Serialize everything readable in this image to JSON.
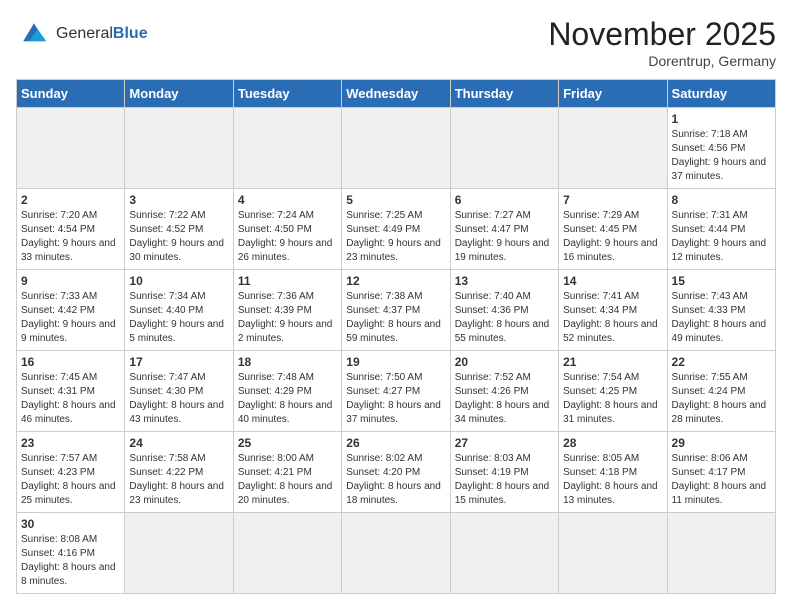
{
  "header": {
    "logo_general": "General",
    "logo_blue": "Blue",
    "title": "November 2025",
    "location": "Dorentrup, Germany"
  },
  "weekdays": [
    "Sunday",
    "Monday",
    "Tuesday",
    "Wednesday",
    "Thursday",
    "Friday",
    "Saturday"
  ],
  "weeks": [
    [
      {
        "day": null,
        "info": null
      },
      {
        "day": null,
        "info": null
      },
      {
        "day": null,
        "info": null
      },
      {
        "day": null,
        "info": null
      },
      {
        "day": null,
        "info": null
      },
      {
        "day": null,
        "info": null
      },
      {
        "day": "1",
        "info": "Sunrise: 7:18 AM\nSunset: 4:56 PM\nDaylight: 9 hours and 37 minutes."
      }
    ],
    [
      {
        "day": "2",
        "info": "Sunrise: 7:20 AM\nSunset: 4:54 PM\nDaylight: 9 hours and 33 minutes."
      },
      {
        "day": "3",
        "info": "Sunrise: 7:22 AM\nSunset: 4:52 PM\nDaylight: 9 hours and 30 minutes."
      },
      {
        "day": "4",
        "info": "Sunrise: 7:24 AM\nSunset: 4:50 PM\nDaylight: 9 hours and 26 minutes."
      },
      {
        "day": "5",
        "info": "Sunrise: 7:25 AM\nSunset: 4:49 PM\nDaylight: 9 hours and 23 minutes."
      },
      {
        "day": "6",
        "info": "Sunrise: 7:27 AM\nSunset: 4:47 PM\nDaylight: 9 hours and 19 minutes."
      },
      {
        "day": "7",
        "info": "Sunrise: 7:29 AM\nSunset: 4:45 PM\nDaylight: 9 hours and 16 minutes."
      },
      {
        "day": "8",
        "info": "Sunrise: 7:31 AM\nSunset: 4:44 PM\nDaylight: 9 hours and 12 minutes."
      }
    ],
    [
      {
        "day": "9",
        "info": "Sunrise: 7:33 AM\nSunset: 4:42 PM\nDaylight: 9 hours and 9 minutes."
      },
      {
        "day": "10",
        "info": "Sunrise: 7:34 AM\nSunset: 4:40 PM\nDaylight: 9 hours and 5 minutes."
      },
      {
        "day": "11",
        "info": "Sunrise: 7:36 AM\nSunset: 4:39 PM\nDaylight: 9 hours and 2 minutes."
      },
      {
        "day": "12",
        "info": "Sunrise: 7:38 AM\nSunset: 4:37 PM\nDaylight: 8 hours and 59 minutes."
      },
      {
        "day": "13",
        "info": "Sunrise: 7:40 AM\nSunset: 4:36 PM\nDaylight: 8 hours and 55 minutes."
      },
      {
        "day": "14",
        "info": "Sunrise: 7:41 AM\nSunset: 4:34 PM\nDaylight: 8 hours and 52 minutes."
      },
      {
        "day": "15",
        "info": "Sunrise: 7:43 AM\nSunset: 4:33 PM\nDaylight: 8 hours and 49 minutes."
      }
    ],
    [
      {
        "day": "16",
        "info": "Sunrise: 7:45 AM\nSunset: 4:31 PM\nDaylight: 8 hours and 46 minutes."
      },
      {
        "day": "17",
        "info": "Sunrise: 7:47 AM\nSunset: 4:30 PM\nDaylight: 8 hours and 43 minutes."
      },
      {
        "day": "18",
        "info": "Sunrise: 7:48 AM\nSunset: 4:29 PM\nDaylight: 8 hours and 40 minutes."
      },
      {
        "day": "19",
        "info": "Sunrise: 7:50 AM\nSunset: 4:27 PM\nDaylight: 8 hours and 37 minutes."
      },
      {
        "day": "20",
        "info": "Sunrise: 7:52 AM\nSunset: 4:26 PM\nDaylight: 8 hours and 34 minutes."
      },
      {
        "day": "21",
        "info": "Sunrise: 7:54 AM\nSunset: 4:25 PM\nDaylight: 8 hours and 31 minutes."
      },
      {
        "day": "22",
        "info": "Sunrise: 7:55 AM\nSunset: 4:24 PM\nDaylight: 8 hours and 28 minutes."
      }
    ],
    [
      {
        "day": "23",
        "info": "Sunrise: 7:57 AM\nSunset: 4:23 PM\nDaylight: 8 hours and 25 minutes."
      },
      {
        "day": "24",
        "info": "Sunrise: 7:58 AM\nSunset: 4:22 PM\nDaylight: 8 hours and 23 minutes."
      },
      {
        "day": "25",
        "info": "Sunrise: 8:00 AM\nSunset: 4:21 PM\nDaylight: 8 hours and 20 minutes."
      },
      {
        "day": "26",
        "info": "Sunrise: 8:02 AM\nSunset: 4:20 PM\nDaylight: 8 hours and 18 minutes."
      },
      {
        "day": "27",
        "info": "Sunrise: 8:03 AM\nSunset: 4:19 PM\nDaylight: 8 hours and 15 minutes."
      },
      {
        "day": "28",
        "info": "Sunrise: 8:05 AM\nSunset: 4:18 PM\nDaylight: 8 hours and 13 minutes."
      },
      {
        "day": "29",
        "info": "Sunrise: 8:06 AM\nSunset: 4:17 PM\nDaylight: 8 hours and 11 minutes."
      }
    ],
    [
      {
        "day": "30",
        "info": "Sunrise: 8:08 AM\nSunset: 4:16 PM\nDaylight: 8 hours and 8 minutes."
      },
      {
        "day": null,
        "info": null
      },
      {
        "day": null,
        "info": null
      },
      {
        "day": null,
        "info": null
      },
      {
        "day": null,
        "info": null
      },
      {
        "day": null,
        "info": null
      },
      {
        "day": null,
        "info": null
      }
    ]
  ]
}
